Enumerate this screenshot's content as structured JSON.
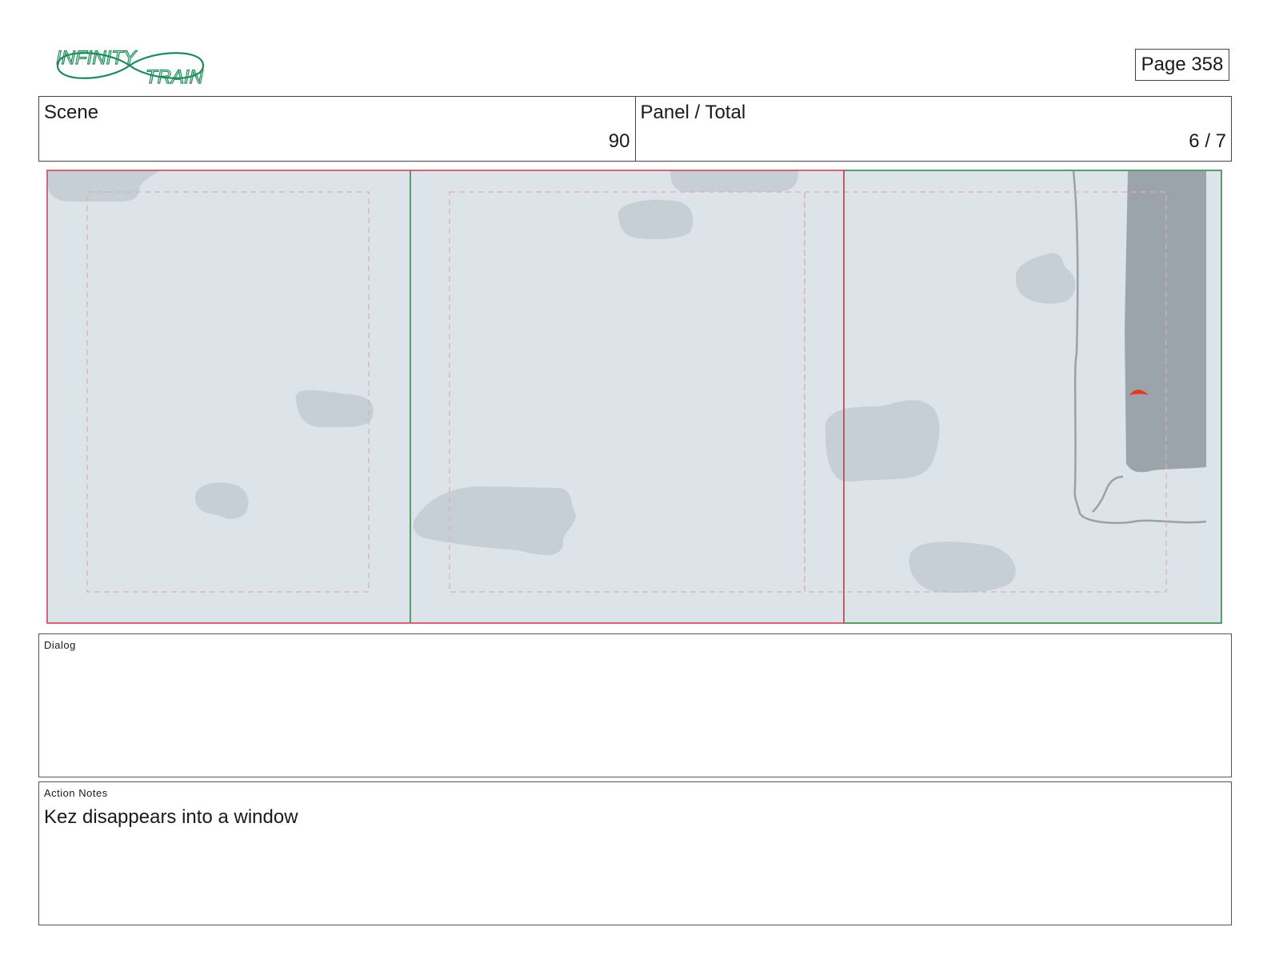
{
  "header": {
    "logo": {
      "icon": "infinity-train-logo",
      "text_line1": "INFINITY",
      "text_line2": "TRAIN",
      "color": "#1f8a5b"
    },
    "page_label": "Page 358"
  },
  "info": {
    "scene_label": "Scene",
    "scene_value": "90",
    "panel_label": "Panel / Total",
    "panel_value": "6 / 7"
  },
  "board": {
    "colors": {
      "background": "#dce4ea",
      "blob": "#c5cfd5",
      "wall": "#9ba4aa",
      "frame_red": "#d0485a",
      "frame_green": "#3b8a4a",
      "safe_area": "#d8b0b4",
      "outline": "#9aa2a8",
      "accent": "#e8391f"
    }
  },
  "dialog": {
    "title": "Dialog",
    "text": ""
  },
  "action_notes": {
    "title": "Action Notes",
    "text": "Kez disappears into a window"
  }
}
